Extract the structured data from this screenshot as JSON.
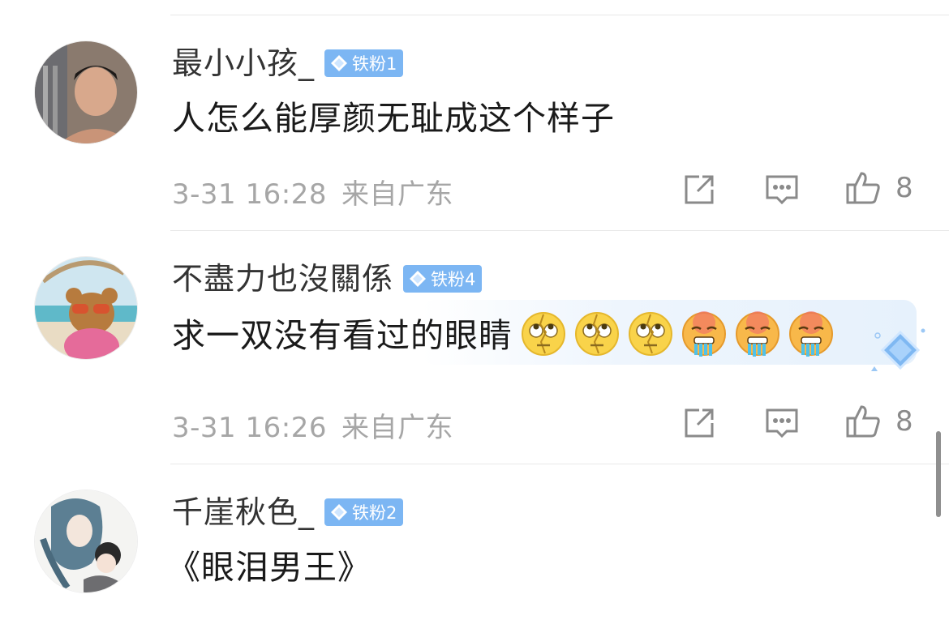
{
  "comments": [
    {
      "username": "最小小孩_",
      "badge": "铁粉1",
      "text": "人怎么能厚颜无耻成这个样子",
      "emojis": [],
      "time": "3-31 16:28",
      "location": "来自广东",
      "likes": "8"
    },
    {
      "username": "不盡力也沒關係",
      "badge": "铁粉4",
      "text": "求一双没有看过的眼睛",
      "emojis": [
        "rolling-eyes-emoji",
        "rolling-eyes-emoji",
        "rolling-eyes-emoji",
        "drooling-emoji",
        "drooling-emoji",
        "drooling-emoji"
      ],
      "time": "3-31 16:26",
      "location": "来自广东",
      "likes": "8"
    },
    {
      "username": "千崖秋色_",
      "badge": "铁粉2",
      "text": "《眼泪男王》"
    }
  ],
  "icons": {
    "share": "share-icon",
    "reply": "comment-icon",
    "like": "thumbs-up-icon",
    "badge": "diamond-icon"
  },
  "colors": {
    "badge_bg": "#7cb6f3",
    "meta_text": "#a6a6a6",
    "highlight_bg": "#e6f1fc"
  }
}
